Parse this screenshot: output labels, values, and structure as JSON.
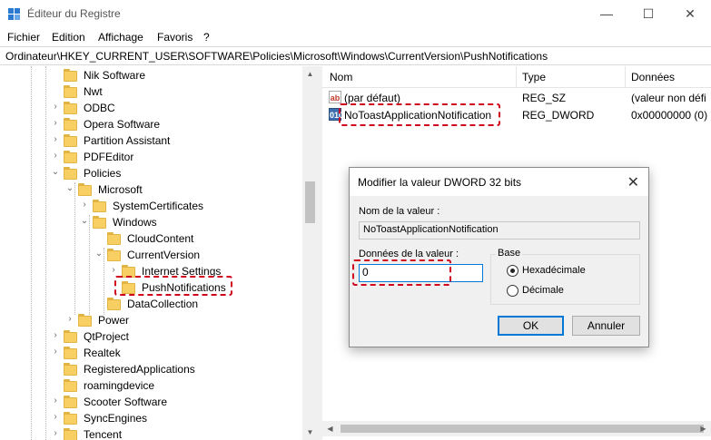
{
  "window": {
    "title": "Éditeur du Registre",
    "minimize_glyph": "—",
    "maximize_glyph": "☐",
    "close_glyph": "✕"
  },
  "menu": [
    "Fichier",
    "Edition",
    "Affichage",
    "Favoris",
    "?"
  ],
  "address": "Ordinateur\\HKEY_CURRENT_USER\\SOFTWARE\\Policies\\Microsoft\\Windows\\CurrentVersion\\PushNotifications",
  "tree": [
    {
      "label": "Nik Software",
      "exp": ""
    },
    {
      "label": "Nwt",
      "exp": ""
    },
    {
      "label": "ODBC",
      "exp": "›"
    },
    {
      "label": "Opera Software",
      "exp": "›"
    },
    {
      "label": "Partition Assistant",
      "exp": "›"
    },
    {
      "label": "PDFEditor",
      "exp": "›"
    },
    {
      "label": "Policies",
      "exp": "⌄"
    },
    {
      "label": "Microsoft",
      "exp": "⌄"
    },
    {
      "label": "SystemCertificates",
      "exp": "›"
    },
    {
      "label": "Windows",
      "exp": "⌄"
    },
    {
      "label": "CloudContent",
      "exp": ""
    },
    {
      "label": "CurrentVersion",
      "exp": "⌄"
    },
    {
      "label": "Internet Settings",
      "exp": "›"
    },
    {
      "label": "PushNotifications",
      "exp": ""
    },
    {
      "label": "DataCollection",
      "exp": ""
    },
    {
      "label": "Power",
      "exp": "›"
    },
    {
      "label": "QtProject",
      "exp": "›"
    },
    {
      "label": "Realtek",
      "exp": "›"
    },
    {
      "label": "RegisteredApplications",
      "exp": ""
    },
    {
      "label": "roamingdevice",
      "exp": ""
    },
    {
      "label": "Scooter Software",
      "exp": "›"
    },
    {
      "label": "SyncEngines",
      "exp": "›"
    },
    {
      "label": "Tencent",
      "exp": "›"
    }
  ],
  "list": {
    "headers": {
      "name": "Nom",
      "type": "Type",
      "data": "Données"
    },
    "rows": [
      {
        "icon": "ab",
        "name": "(par défaut)",
        "type": "REG_SZ",
        "data": "(valeur non défi"
      },
      {
        "icon": "010",
        "name": "NoToastApplicationNotification",
        "type": "REG_DWORD",
        "data": "0x00000000 (0)"
      }
    ]
  },
  "dialog": {
    "title": "Modifier la valeur DWORD 32 bits",
    "close": "✕",
    "value_name_label": "Nom de la valeur :",
    "value_name": "NoToastApplicationNotification",
    "value_data_label": "Données de la valeur :",
    "value_data": "0",
    "base_label": "Base",
    "base_options": [
      "Hexadécimale",
      "Décimale"
    ],
    "base_selected": "Hexadécimale",
    "ok": "OK",
    "cancel": "Annuler"
  },
  "colors": {
    "highlight": "#d0021b",
    "folder": "#f7cf63",
    "accent": "#0078d7"
  }
}
